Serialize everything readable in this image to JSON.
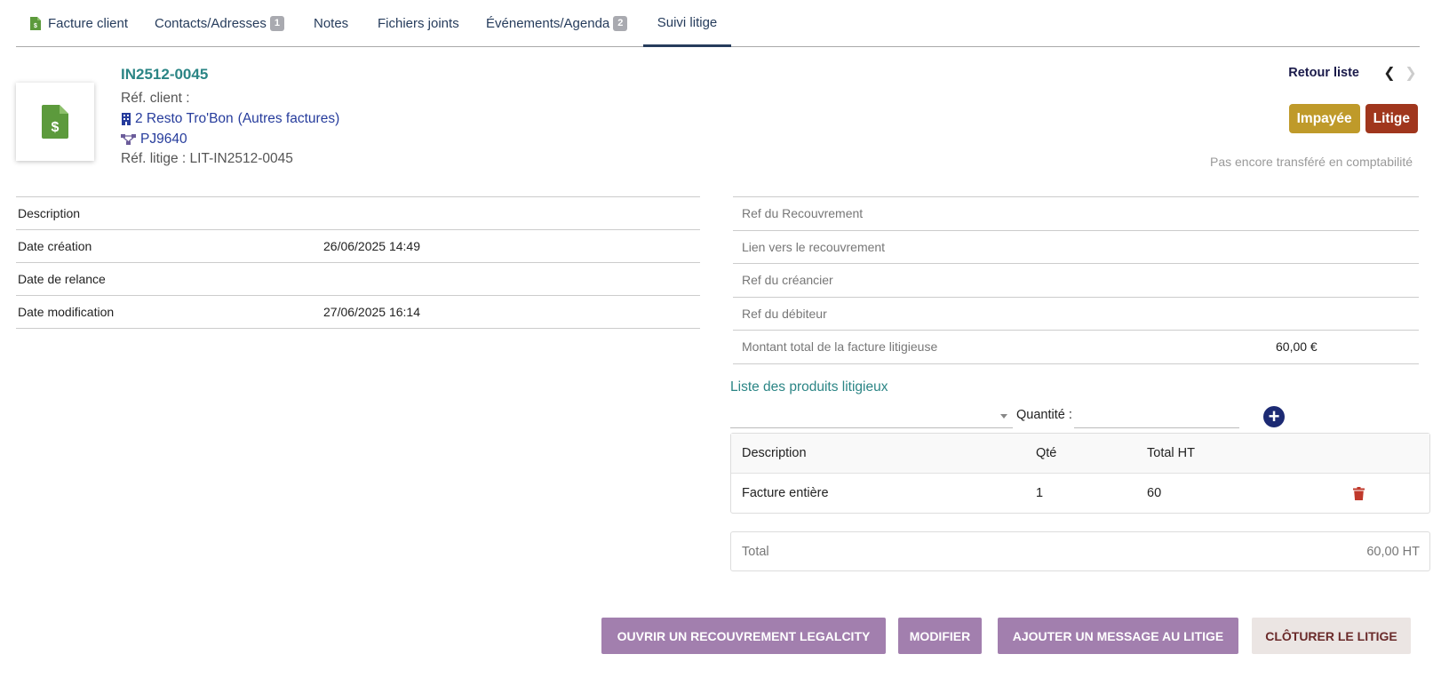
{
  "tabs": [
    {
      "label": "Facture client",
      "badge": null
    },
    {
      "label": "Contacts/Adresses",
      "badge": "1"
    },
    {
      "label": "Notes",
      "badge": null
    },
    {
      "label": "Fichiers joints",
      "badge": null
    },
    {
      "label": "Événements/Agenda",
      "badge": "2"
    },
    {
      "label": "Suivi litige",
      "badge": null,
      "active": true
    }
  ],
  "header": {
    "ref": "IN2512-0045",
    "ref_client": "Réf. client :",
    "thirdparty": "2 Resto Tro'Bon",
    "thirdparty_note": "(Autres factures)",
    "project": "PJ9640",
    "ref_litige": "Réf. litige : LIT-IN2512-0045",
    "back_list": "Retour liste",
    "prev_icon": "chevron-left-icon",
    "next_icon": "chevron-right-icon",
    "status_unpaid": "Impayée",
    "status_litige": "Litige",
    "compta_note": "Pas encore transféré en comptabilité"
  },
  "left_table": [
    {
      "label": "Description",
      "value": ""
    },
    {
      "label": "Date création",
      "value": "26/06/2025 14:49"
    },
    {
      "label": "Date de relance",
      "value": ""
    },
    {
      "label": "Date modification",
      "value": "27/06/2025 16:14"
    }
  ],
  "right_table": [
    {
      "label": "Ref du Recouvrement",
      "value": ""
    },
    {
      "label": "Lien vers le recouvrement",
      "value": ""
    },
    {
      "label": "Ref du créancier",
      "value": ""
    },
    {
      "label": "Ref du débiteur",
      "value": ""
    },
    {
      "label": "Montant total de la facture litigieuse",
      "value": "60,00 €"
    }
  ],
  "products": {
    "title": "Liste des produits litigieux",
    "qty_label": "Quantité :",
    "columns": [
      "Description",
      "Qté",
      "Total HT"
    ],
    "rows": [
      {
        "description": "Facture entière",
        "qty": "1",
        "total": "60"
      }
    ],
    "total_label": "Total",
    "total_value": "60,00 HT"
  },
  "actions": {
    "open_recovery": "OUVRIR UN RECOUVREMENT LEGALCITY",
    "modify": "MODIFIER",
    "add_message": "AJOUTER UN MESSAGE AU LITIGE",
    "close_litige": "CLÔTURER LE LITIGE"
  },
  "colors": {
    "accent_teal": "#2b8585",
    "navy": "#263c5c",
    "unpaid": "#bf9a2a",
    "litige": "#a0361d",
    "action_purple": "#a27fae",
    "invoice_green": "#5c9a3c",
    "trash_red": "#c0392b"
  }
}
